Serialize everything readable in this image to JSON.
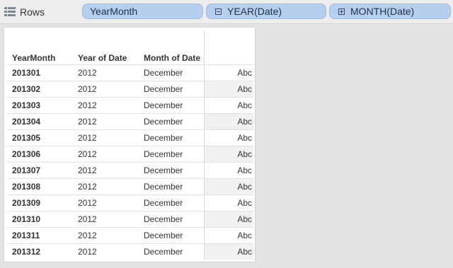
{
  "shelf": {
    "label": "Rows",
    "pills": [
      {
        "label": "YearMonth"
      },
      {
        "label": "YEAR(Date)",
        "icon": "collapse-box-icon"
      },
      {
        "label": "MONTH(Date)",
        "icon": "expand-box-icon"
      }
    ]
  },
  "table": {
    "headers": [
      "YearMonth",
      "Year of Date",
      "Month of Date"
    ],
    "rows": [
      [
        "201301",
        "2012",
        "December",
        "Abc"
      ],
      [
        "201302",
        "2012",
        "December",
        "Abc"
      ],
      [
        "201303",
        "2012",
        "December",
        "Abc"
      ],
      [
        "201304",
        "2012",
        "December",
        "Abc"
      ],
      [
        "201305",
        "2012",
        "December",
        "Abc"
      ],
      [
        "201306",
        "2012",
        "December",
        "Abc"
      ],
      [
        "201307",
        "2012",
        "December",
        "Abc"
      ],
      [
        "201308",
        "2012",
        "December",
        "Abc"
      ],
      [
        "201309",
        "2012",
        "December",
        "Abc"
      ],
      [
        "201310",
        "2012",
        "December",
        "Abc"
      ],
      [
        "201311",
        "2012",
        "December",
        "Abc"
      ],
      [
        "201312",
        "2012",
        "December",
        "Abc"
      ]
    ]
  },
  "colors": {
    "pill": "#b7cfee",
    "alt_cell": "#f1f1f1"
  }
}
